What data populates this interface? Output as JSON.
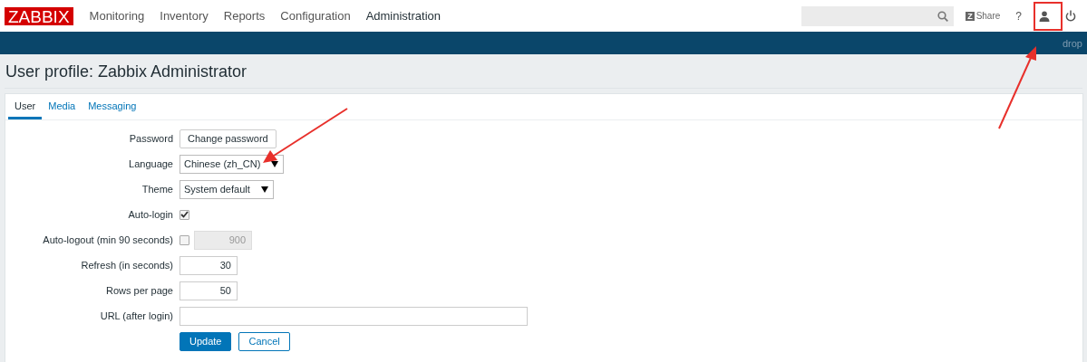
{
  "logo": "ZABBIX",
  "menu": [
    {
      "label": "Monitoring",
      "selected": false
    },
    {
      "label": "Inventory",
      "selected": false
    },
    {
      "label": "Reports",
      "selected": false
    },
    {
      "label": "Configuration",
      "selected": false
    },
    {
      "label": "Administration",
      "selected": true
    }
  ],
  "share": {
    "badge": "Z",
    "label": "Share"
  },
  "help": "?",
  "subbar": "drop",
  "title": "User profile: Zabbix Administrator",
  "tabs": [
    {
      "label": "User",
      "selected": true
    },
    {
      "label": "Media",
      "selected": false
    },
    {
      "label": "Messaging",
      "selected": false
    }
  ],
  "rows": [
    {
      "kind": "button",
      "label": "Password",
      "value": "Change password"
    },
    {
      "kind": "select",
      "label": "Language",
      "value": "Chinese (zh_CN)"
    },
    {
      "kind": "select",
      "label": "Theme",
      "value": "System default"
    },
    {
      "kind": "checkbox",
      "label": "Auto-login",
      "checked": true
    },
    {
      "kind": "checkbox_number",
      "label": "Auto-logout (min 90 seconds)",
      "checked": false,
      "disabled": true,
      "value": "900"
    },
    {
      "kind": "number",
      "label": "Refresh (in seconds)",
      "value": "30"
    },
    {
      "kind": "number",
      "label": "Rows per page",
      "value": "50"
    },
    {
      "kind": "text",
      "label": "URL (after login)"
    }
  ],
  "buttons": [
    {
      "label": "Update",
      "primary": true
    },
    {
      "label": "Cancel",
      "primary": false
    }
  ]
}
